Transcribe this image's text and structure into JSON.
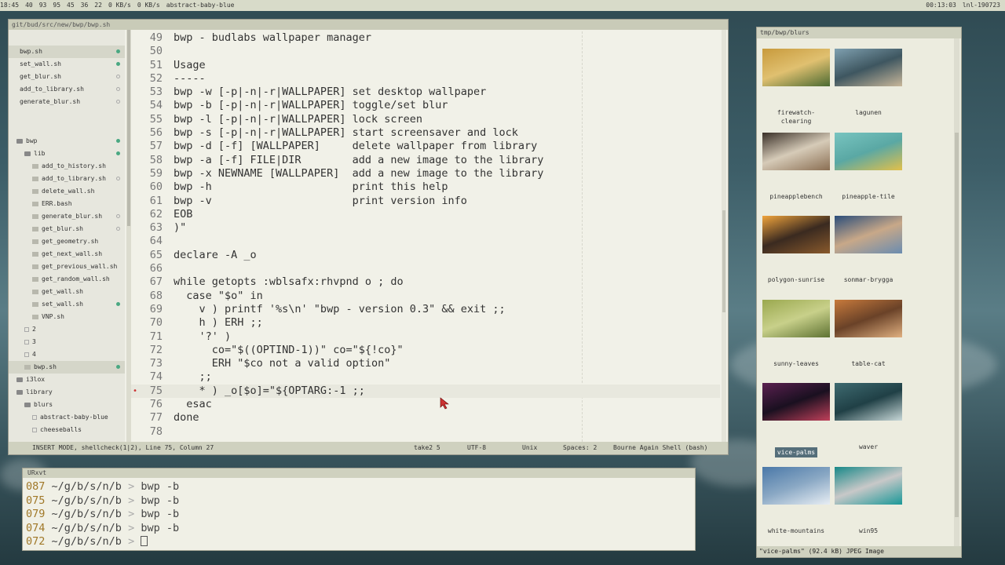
{
  "topbar": {
    "time_left": "18:45",
    "items": [
      "40",
      "93",
      "95",
      "45",
      "36",
      "22",
      "0 KB/s",
      "0 KB/s"
    ],
    "title": "abstract-baby-blue",
    "clock": "00:13:03",
    "host": "lnl-190723"
  },
  "editor": {
    "title": "git/bud/src/new/bwp/bwp.sh",
    "open_files": [
      {
        "name": "bwp.sh",
        "status": "green",
        "active": true
      },
      {
        "name": "set_wall.sh",
        "status": "green"
      },
      {
        "name": "get_blur.sh",
        "status": "hollow"
      },
      {
        "name": "add_to_library.sh",
        "status": "hollow"
      },
      {
        "name": "generate_blur.sh",
        "status": "hollow"
      }
    ],
    "tree": [
      {
        "name": "bwp",
        "kind": "folder",
        "indent": 1,
        "status": "green"
      },
      {
        "name": "lib",
        "kind": "folder",
        "indent": 2,
        "status": "green"
      },
      {
        "name": "add_to_history.sh",
        "kind": "file",
        "indent": 3
      },
      {
        "name": "add_to_library.sh",
        "kind": "file",
        "indent": 3,
        "status": "hollow"
      },
      {
        "name": "delete_wall.sh",
        "kind": "file",
        "indent": 3
      },
      {
        "name": "ERR.bash",
        "kind": "file",
        "indent": 3
      },
      {
        "name": "generate_blur.sh",
        "kind": "file",
        "indent": 3,
        "status": "hollow"
      },
      {
        "name": "get_blur.sh",
        "kind": "file",
        "indent": 3,
        "status": "hollow"
      },
      {
        "name": "get_geometry.sh",
        "kind": "file",
        "indent": 3
      },
      {
        "name": "get_next_wall.sh",
        "kind": "file",
        "indent": 3
      },
      {
        "name": "get_previous_wall.sh",
        "kind": "file",
        "indent": 3
      },
      {
        "name": "get_random_wall.sh",
        "kind": "file",
        "indent": 3
      },
      {
        "name": "get_wall.sh",
        "kind": "file",
        "indent": 3
      },
      {
        "name": "set_wall.sh",
        "kind": "file",
        "indent": 3,
        "status": "green"
      },
      {
        "name": "VNP.sh",
        "kind": "file",
        "indent": 3
      },
      {
        "name": "2",
        "kind": "tag",
        "indent": 2
      },
      {
        "name": "3",
        "kind": "tag",
        "indent": 2
      },
      {
        "name": "4",
        "kind": "tag",
        "indent": 2
      },
      {
        "name": "bwp.sh",
        "kind": "file",
        "indent": 2,
        "status": "green",
        "active": true
      },
      {
        "name": "i3lox",
        "kind": "folder",
        "indent": 1
      },
      {
        "name": "library",
        "kind": "folder",
        "indent": 1
      },
      {
        "name": "blurs",
        "kind": "folder",
        "indent": 2
      },
      {
        "name": "abstract-baby-blue",
        "kind": "tag",
        "indent": 3
      },
      {
        "name": "cheeseballs",
        "kind": "tag",
        "indent": 3
      }
    ],
    "lines": [
      {
        "n": "49",
        "t": "bwp - budlabs wallpaper manager"
      },
      {
        "n": "50",
        "t": ""
      },
      {
        "n": "51",
        "t": "Usage"
      },
      {
        "n": "52",
        "t": "-----"
      },
      {
        "n": "53",
        "t": "bwp -w [-p|-n|-r|WALLPAPER] set desktop wallpaper"
      },
      {
        "n": "54",
        "t": "bwp -b [-p|-n|-r|WALLPAPER] toggle/set blur"
      },
      {
        "n": "55",
        "t": "bwp -l [-p|-n|-r|WALLPAPER] lock screen"
      },
      {
        "n": "56",
        "t": "bwp -s [-p|-n|-r|WALLPAPER] start screensaver and lock"
      },
      {
        "n": "57",
        "t": "bwp -d [-f] [WALLPAPER]     delete wallpaper from library"
      },
      {
        "n": "58",
        "t": "bwp -a [-f] FILE|DIR        add a new image to the library"
      },
      {
        "n": "59",
        "t": "bwp -x NEWNAME [WALLPAPER]  add a new image to the library"
      },
      {
        "n": "60",
        "t": "bwp -h                      print this help"
      },
      {
        "n": "61",
        "t": "bwp -v                      print version info"
      },
      {
        "n": "62",
        "t": "EOB"
      },
      {
        "n": "63",
        "t": ")\""
      },
      {
        "n": "64",
        "t": ""
      },
      {
        "n": "65",
        "t": "declare -A _o"
      },
      {
        "n": "66",
        "t": ""
      },
      {
        "n": "67",
        "t": "while getopts :wblsafx:rhvpnd o ; do"
      },
      {
        "n": "68",
        "t": "  case \"$o\" in"
      },
      {
        "n": "69",
        "t": "    v ) printf '%s\\n' \"bwp - version 0.3\" && exit ;;"
      },
      {
        "n": "70",
        "t": "    h ) ERH ;;"
      },
      {
        "n": "71",
        "t": "    '?' )"
      },
      {
        "n": "72",
        "t": "      co=\"$((OPTIND-1))\" co=\"${!co}\""
      },
      {
        "n": "73",
        "t": "      ERH \"$co not a valid option\""
      },
      {
        "n": "74",
        "t": "    ;;"
      },
      {
        "n": "75",
        "t": "    * ) _o[$o]=\"${OPTARG:-1 ;;",
        "current": true,
        "mark": "•"
      },
      {
        "n": "76",
        "t": "  esac"
      },
      {
        "n": "77",
        "t": "done"
      },
      {
        "n": "78",
        "t": ""
      }
    ],
    "statusbar": {
      "mode": "INSERT MODE, shellcheck(1|2), Line 75, Column 27",
      "branch": "take2 5",
      "encoding": "UTF-8",
      "eol": "Unix",
      "indent": "Spaces: 2",
      "syntax": "Bourne Again Shell (bash)"
    }
  },
  "terminal": {
    "title": "URxvt",
    "lines": [
      {
        "num": "087",
        "path": " ~/g/b/s/n/b ",
        "gt": ">",
        "cmd": " bwp -b"
      },
      {
        "num": "075",
        "path": " ~/g/b/s/n/b ",
        "gt": ">",
        "cmd": " bwp -b"
      },
      {
        "num": "079",
        "path": " ~/g/b/s/n/b ",
        "gt": ">",
        "cmd": " bwp -b"
      },
      {
        "num": "074",
        "path": " ~/g/b/s/n/b ",
        "gt": ">",
        "cmd": " bwp -b"
      },
      {
        "num": "072",
        "path": " ~/g/b/s/n/b ",
        "gt": ">",
        "cmd": " "
      }
    ]
  },
  "viewer": {
    "title": "tmp/bwp/blurs",
    "thumbs": [
      {
        "label": "firewatch-clearing",
        "colors": [
          "#c89a3c",
          "#4b6a32",
          "#e0c070"
        ]
      },
      {
        "label": "lagunen",
        "colors": [
          "#7fa0b0",
          "#c8b79a",
          "#3e5660"
        ]
      },
      {
        "label": "pineapplebench",
        "colors": [
          "#3a3028",
          "#8a6e52",
          "#d6cbb8"
        ]
      },
      {
        "label": "pineapple-tile",
        "colors": [
          "#78c4c0",
          "#e2c04a",
          "#5aa8a4"
        ]
      },
      {
        "label": "polygon-sunrise",
        "colors": [
          "#f0a43c",
          "#8a5a2c",
          "#3a2a20"
        ]
      },
      {
        "label": "sonmar-brygga",
        "colors": [
          "#2a4d7a",
          "#6a8cb0",
          "#c8a888"
        ]
      },
      {
        "label": "sunny-leaves",
        "colors": [
          "#9aa84e",
          "#5e7232",
          "#c8d08a"
        ]
      },
      {
        "label": "table-cat",
        "colors": [
          "#c87a3c",
          "#e0b080",
          "#6a4228"
        ]
      },
      {
        "label": "vice-palms",
        "colors": [
          "#5a2050",
          "#c0405a",
          "#1a1020"
        ],
        "selected": true
      },
      {
        "label": "waver",
        "colors": [
          "#3e6a70",
          "#c8d8d8",
          "#204046"
        ]
      },
      {
        "label": "white-mountains",
        "colors": [
          "#4a78a8",
          "#e8eef4",
          "#8aa8c4"
        ]
      },
      {
        "label": "win95",
        "colors": [
          "#188888",
          "#1a9898",
          "#c8c8c8"
        ]
      }
    ],
    "status": "\"vice-palms\" (92.4 kB) JPEG Image"
  }
}
